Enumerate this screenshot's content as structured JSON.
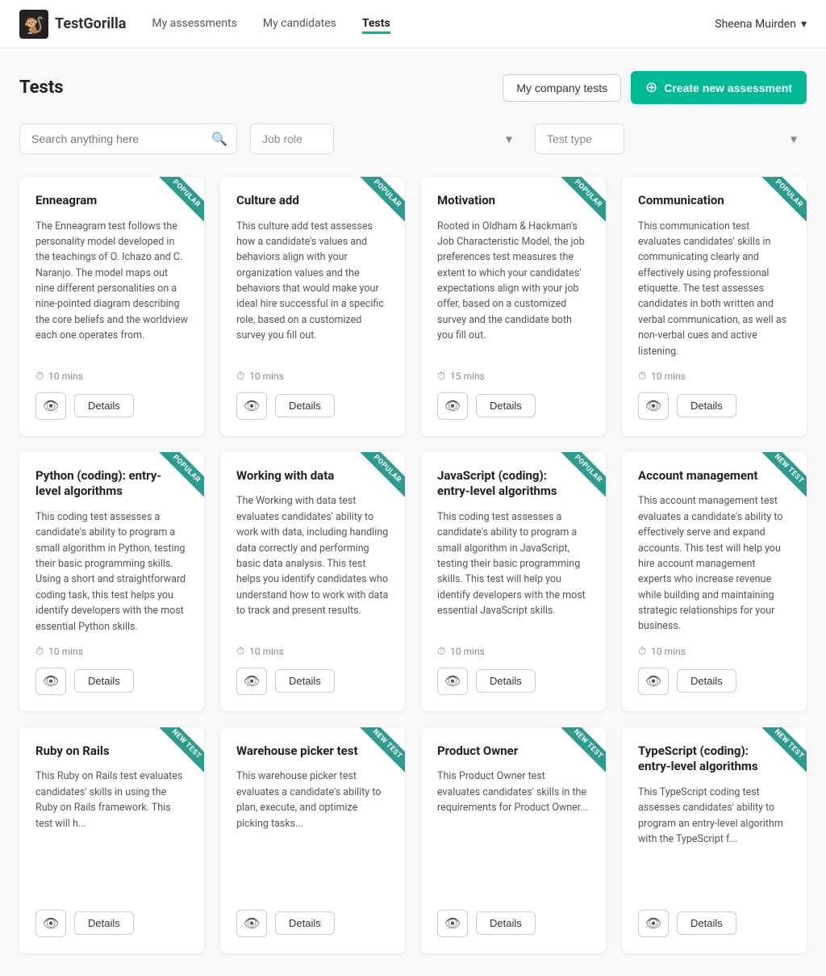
{
  "navbar": {
    "logo_text": "TestGorilla",
    "nav_items": [
      {
        "label": "My assessments",
        "active": false
      },
      {
        "label": "My candidates",
        "active": false
      },
      {
        "label": "Tests",
        "active": true
      }
    ],
    "user": "Sheena Muirden"
  },
  "page": {
    "title": "Tests",
    "btn_company": "My company tests",
    "btn_create": "Create new assessment"
  },
  "filters": {
    "search_placeholder": "Search anything here",
    "job_role_placeholder": "Job role",
    "test_type_placeholder": "Test type"
  },
  "cards": [
    {
      "title": "Enneagram",
      "badge": "POPULAR",
      "badge_type": "popular",
      "desc": "The Enneagram test follows the personality model developed in the teachings of O. Ichazo and C. Naranjo. The model maps out nine different personalities on a nine-pointed diagram describing the core beliefs and the worldview each one operates from.",
      "duration": "10 mins"
    },
    {
      "title": "Culture add",
      "badge": "POPULAR",
      "badge_type": "popular",
      "desc": "This culture add test assesses how a candidate's values and behaviors align with your organization values and the behaviors that would make your ideal hire successful in a specific role, based on a customized survey you fill out.",
      "duration": "10 mins"
    },
    {
      "title": "Motivation",
      "badge": "POPULAR",
      "badge_type": "popular",
      "desc": "Rooted in Oldham & Hackman's Job Characteristic Model, the job preferences test measures the extent to which your candidates' expectations align with your job offer, based on a customized survey and the candidate both you fill out.",
      "duration": "15 mins"
    },
    {
      "title": "Communication",
      "badge": "POPULAR",
      "badge_type": "popular",
      "desc": "This communication test evaluates candidates' skills in communicating clearly and effectively using professional etiquette. The test assesses candidates in both written and verbal communication, as well as non-verbal cues and active listening.",
      "duration": "10 mins"
    },
    {
      "title": "Python (coding): entry-level algorithms",
      "badge": "POPULAR",
      "badge_type": "popular",
      "desc": "This coding test assesses a candidate's ability to program a small algorithm in Python, testing their basic programming skills. Using a short and straightforward coding task, this test helps you identify developers with the most essential Python skills.",
      "duration": "10 mins"
    },
    {
      "title": "Working with data",
      "badge": "POPULAR",
      "badge_type": "popular",
      "desc": "The Working with data test evaluates candidates' ability to work with data, including handling data correctly and performing basic data analysis. This test helps you identify candidates who understand how to work with data to track and present results.",
      "duration": "10 mins"
    },
    {
      "title": "JavaScript (coding): entry-level algorithms",
      "badge": "POPULAR",
      "badge_type": "popular",
      "desc": "This coding test assesses a candidate's ability to program a small algorithm in JavaScript, testing their basic programming skills. This test will help you identify developers with the most essential JavaScript skills.",
      "duration": "10 mins"
    },
    {
      "title": "Account management",
      "badge": "NEW TEST",
      "badge_type": "new",
      "desc": "This account management test evaluates a candidate's ability to effectively serve and expand accounts. This test will help you hire account management experts who increase revenue while building and maintaining strategic relationships for your business.",
      "duration": "10 mins"
    },
    {
      "title": "Ruby on Rails",
      "badge": "NEW TEST",
      "badge_type": "new",
      "desc": "This Ruby on Rails test evaluates candidates' skills in using the Ruby on Rails framework. This test will h...",
      "duration": ""
    },
    {
      "title": "Warehouse picker test",
      "badge": "NEW TEST",
      "badge_type": "new",
      "desc": "This warehouse picker test evaluates a candidate's ability to plan, execute, and optimize picking tasks...",
      "duration": ""
    },
    {
      "title": "Product Owner",
      "badge": "NEW TEST",
      "badge_type": "new",
      "desc": "This Product Owner test evaluates candidates' skills in the requirements for Product Owner...",
      "duration": ""
    },
    {
      "title": "TypeScript (coding): entry-level algorithms",
      "badge": "NEW TEST",
      "badge_type": "new",
      "desc": "This TypeScript coding test assesses candidates' ability to program an entry-level algorithm with the TypeScript f...",
      "duration": ""
    }
  ],
  "btn_labels": {
    "preview": "👁",
    "details": "Details"
  }
}
